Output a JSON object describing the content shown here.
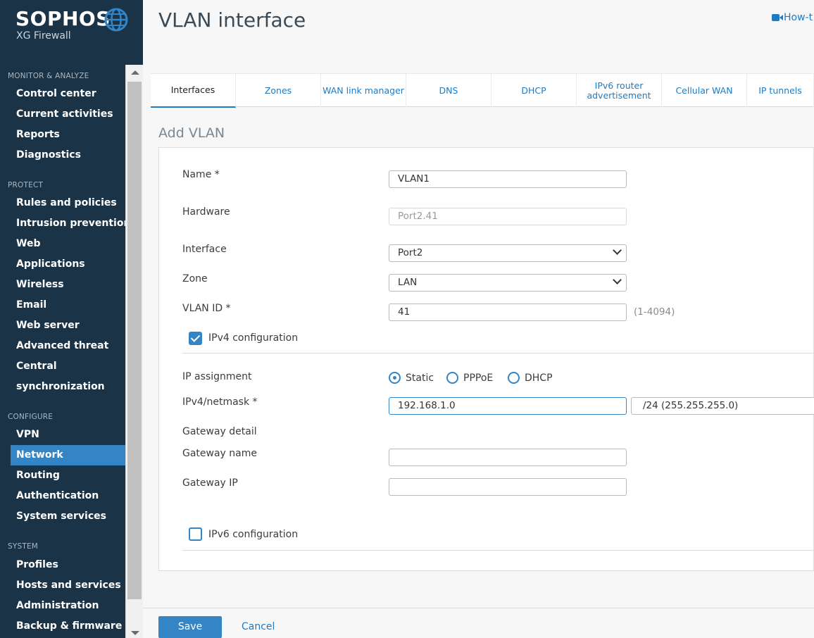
{
  "brand": {
    "name": "SOPHOS",
    "product": "XG Firewall"
  },
  "sidebar": {
    "sections": [
      {
        "title": "MONITOR & ANALYZE",
        "items": [
          "Control center",
          "Current activities",
          "Reports",
          "Diagnostics"
        ]
      },
      {
        "title": "PROTECT",
        "items": [
          "Rules and policies",
          "Intrusion prevention",
          "Web",
          "Applications",
          "Wireless",
          "Email",
          "Web server",
          "Advanced threat",
          "Central",
          "synchronization"
        ]
      },
      {
        "title": "CONFIGURE",
        "items": [
          "VPN",
          "Network",
          "Routing",
          "Authentication",
          "System services"
        ]
      },
      {
        "title": "SYSTEM",
        "items": [
          "Profiles",
          "Hosts and services",
          "Administration",
          "Backup & firmware"
        ]
      }
    ],
    "active_item": "Network"
  },
  "header": {
    "title": "VLAN interface",
    "howto_label": "How-t"
  },
  "tabs": [
    {
      "label": "Interfaces"
    },
    {
      "label": "Zones"
    },
    {
      "label": "WAN link manager"
    },
    {
      "label": "DNS"
    },
    {
      "label": "DHCP"
    },
    {
      "label": "IPv6 router advertisement"
    },
    {
      "label": "Cellular WAN"
    },
    {
      "label": "IP tunnels"
    }
  ],
  "active_tab": "Interfaces",
  "form": {
    "section_title": "Add VLAN",
    "name": {
      "label": "Name *",
      "value": "VLAN1"
    },
    "hardware": {
      "label": "Hardware",
      "value": "Port2.41"
    },
    "interface": {
      "label": "Interface",
      "value": "Port2"
    },
    "zone": {
      "label": "Zone",
      "value": "LAN"
    },
    "vlan_id": {
      "label": "VLAN ID *",
      "value": "41",
      "hint": "(1-4094)"
    },
    "ipv4_config": {
      "label": "IPv4 configuration",
      "checked": true
    },
    "ip_assignment": {
      "label": "IP assignment",
      "options": [
        "Static",
        "PPPoE",
        "DHCP"
      ],
      "selected": "Static"
    },
    "ipv4_netmask": {
      "label": "IPv4/netmask *",
      "ip_value": "192.168.1.0",
      "netmask_value": "/24 (255.255.255.0)"
    },
    "gateway_detail": {
      "label": "Gateway detail"
    },
    "gateway_name": {
      "label": "Gateway name",
      "value": ""
    },
    "gateway_ip": {
      "label": "Gateway IP",
      "value": ""
    },
    "ipv6_config": {
      "label": "IPv6 configuration",
      "checked": false
    }
  },
  "footer": {
    "save_label": "Save",
    "cancel_label": "Cancel"
  },
  "colors": {
    "sidebar_bg": "#1a3346",
    "accent": "#3385c6",
    "link": "#1d7bc4"
  }
}
